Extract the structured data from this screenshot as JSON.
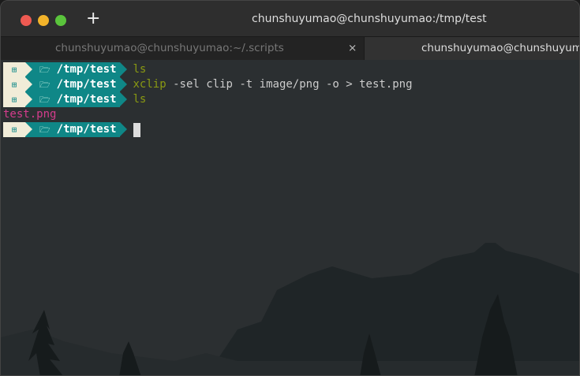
{
  "window": {
    "title": "chunshuyumao@chunshuyumao:/tmp/test",
    "new_tab": "+"
  },
  "tabs": [
    {
      "label": "chunshuyumao@chunshuyumao:~/.scripts",
      "close": "×"
    },
    {
      "label": "chunshuyumao@chunshuyumao:/tmp/test"
    }
  ],
  "terminal": {
    "prompt_icon": "⊞",
    "folder_icon": "🗁",
    "cwd": "/tmp/test",
    "lines": [
      {
        "cmd": "ls",
        "args": ""
      },
      {
        "cmd": "xclip",
        "args": " -sel clip -t image/png -o > test.png"
      },
      {
        "cmd": "ls",
        "args": ""
      }
    ],
    "output": "test.png"
  }
}
